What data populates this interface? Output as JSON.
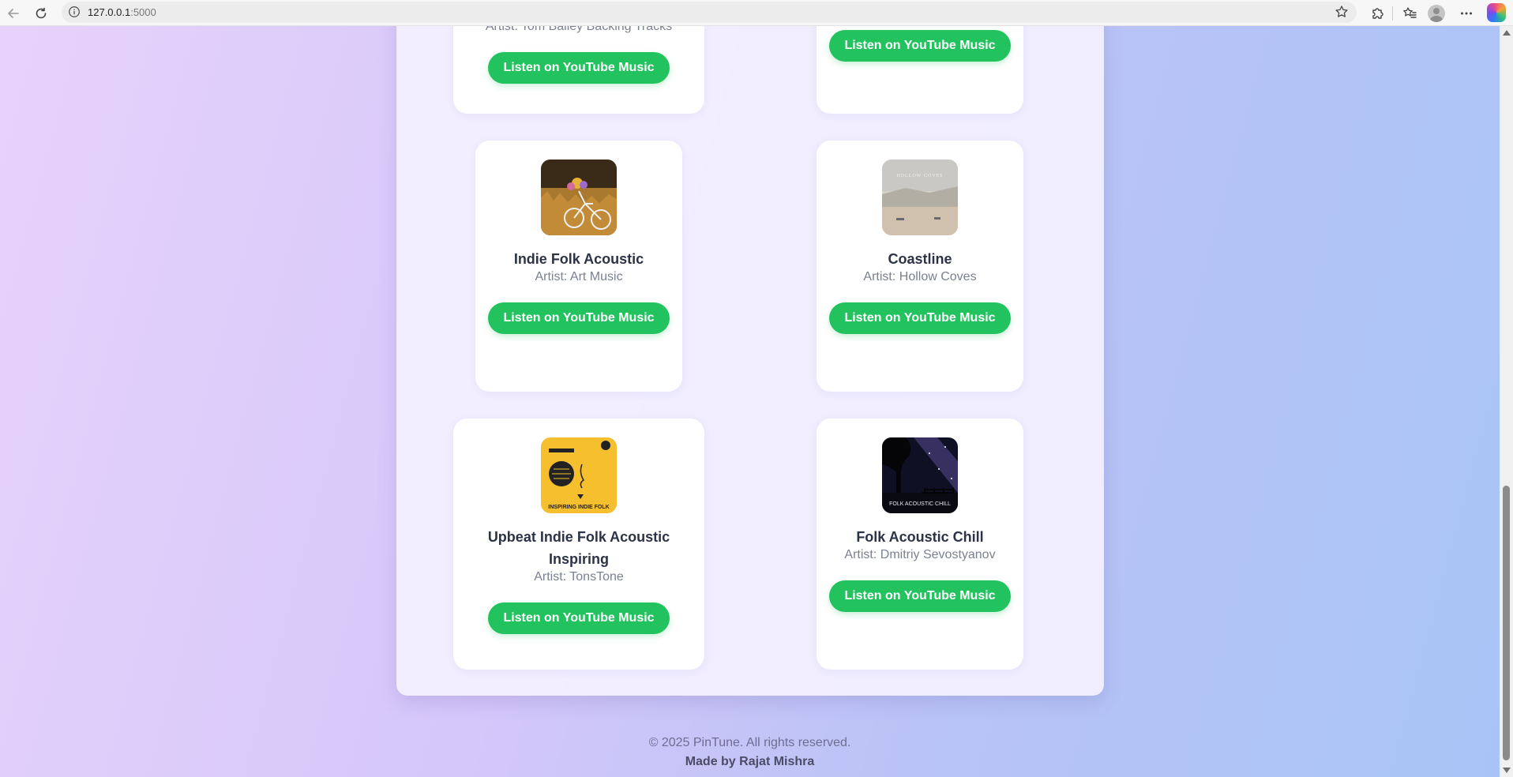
{
  "browser": {
    "url_host": "127.0.0.1",
    "url_port": ":5000"
  },
  "icons": {
    "back": "arrow-left-icon",
    "reload": "reload-icon",
    "site_info": "info-icon",
    "favorite": "star-icon",
    "extensions": "puzzle-icon",
    "favorites_list": "favorites-icon",
    "profile": "avatar",
    "menu": "more-icon",
    "copilot": "copilot-icon"
  },
  "colors": {
    "button_green": "#22c35e",
    "title_text": "#2c3346",
    "artist_text": "#7b8191"
  },
  "tracks": [
    {
      "title": "",
      "artist": "Artist: Tom Bailey Backing Tracks",
      "button": "Listen on YouTube Music"
    },
    {
      "title": "",
      "artist": "",
      "button": "Listen on YouTube Music"
    },
    {
      "title": "Indie Folk Acoustic",
      "artist": "Artist: Art Music",
      "button": "Listen on YouTube Music"
    },
    {
      "title": "Coastline",
      "artist": "Artist: Hollow Coves",
      "button": "Listen on YouTube Music",
      "art_text": "HOLLOW COVES"
    },
    {
      "title": "Upbeat Indie Folk Acoustic Inspiring",
      "artist": "Artist: TonsTone",
      "button": "Listen on YouTube Music",
      "art_text": "INSPIRING INDIE FOLK"
    },
    {
      "title": "Folk Acoustic Chill",
      "artist": "Artist: Dmitriy Sevostyanov",
      "button": "Listen on YouTube Music",
      "art_text": "FOLK ACOUSTIC CHILL"
    }
  ],
  "footer": {
    "copyright": "© 2025 PinTune. All rights reserved.",
    "made_by": "Made by Rajat Mishra"
  }
}
